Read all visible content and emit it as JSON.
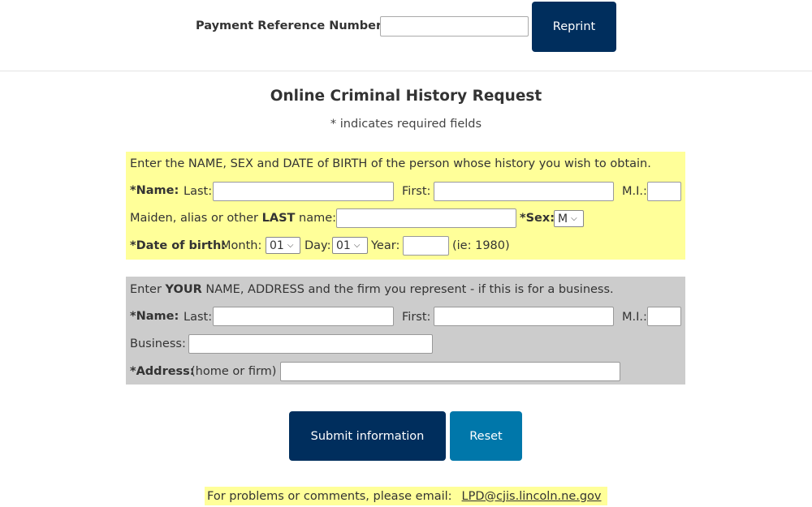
{
  "reference": {
    "label": "Payment Reference Number:",
    "value": "",
    "reprint_label": "Reprint"
  },
  "form": {
    "title": "Online Criminal History Request",
    "required_note": "* indicates required fields"
  },
  "subject": {
    "instructions": "Enter the NAME, SEX and DATE of BIRTH of the person whose history you wish to obtain.",
    "name_label": "*Name:",
    "last_label": "Last:",
    "first_label": "First:",
    "mi_label": "M.I.:",
    "maiden_label_pre": "Maiden, alias or other ",
    "maiden_label_bold": "LAST",
    "maiden_label_post": " name:",
    "sex_label": "*Sex:",
    "sex_value": "M",
    "dob_label": "*Date of birth:",
    "month_label": "Month:",
    "month_value": "01",
    "day_label": "Day:",
    "day_value": "01",
    "year_label": "Year:",
    "year_hint": "(ie: 1980)"
  },
  "requester": {
    "instructions_pre": "Enter ",
    "instructions_bold": "YOUR",
    "instructions_post": " NAME, ADDRESS and the firm you represent - if this is for a business.",
    "name_label": "*Name:",
    "last_label": "Last:",
    "first_label": "First:",
    "mi_label": "M.I.:",
    "business_label": "Business:",
    "address_label": "*Address:",
    "address_hint": "(home or firm)"
  },
  "actions": {
    "submit_label": "Submit information",
    "reset_label": "Reset"
  },
  "footer": {
    "text": "For problems or comments, please email:",
    "email": "LPD@cjis.lincoln.ne.gov"
  },
  "colors": {
    "primary_button": "#002e5d",
    "reset_button": "#0077aa",
    "highlight": "#ffff99",
    "gray_panel": "#cccccc"
  }
}
